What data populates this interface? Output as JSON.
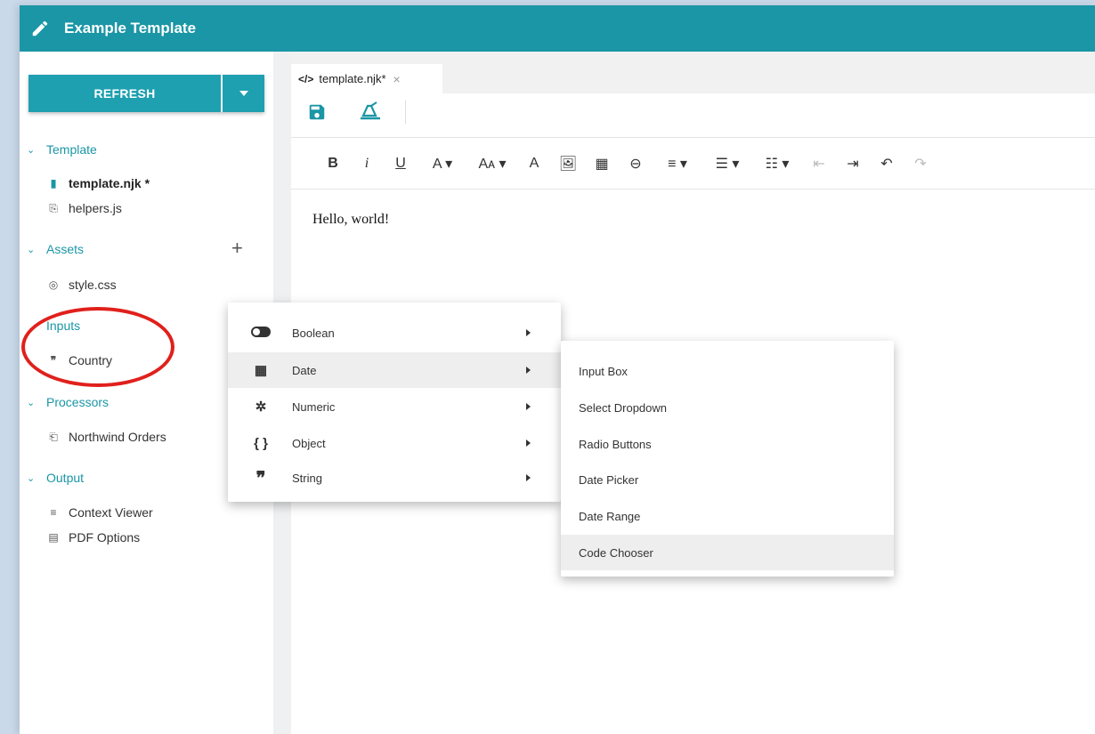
{
  "app": {
    "title": "Example Template"
  },
  "sidebar": {
    "refresh_label": "REFRESH",
    "sections": {
      "template": {
        "label": "Template",
        "items": [
          {
            "label": "template.njk *",
            "icon": "file-icon"
          },
          {
            "label": "helpers.js",
            "icon": "script-icon"
          }
        ]
      },
      "assets": {
        "label": "Assets",
        "add_icon": "+",
        "items": [
          {
            "label": "style.css",
            "icon": "palette-icon"
          }
        ]
      },
      "inputs": {
        "label": "Inputs",
        "items": [
          {
            "label": "Country",
            "icon": "quote-icon"
          }
        ]
      },
      "processors": {
        "label": "Processors",
        "items": [
          {
            "label": "Northwind Orders",
            "icon": "processor-icon"
          }
        ]
      },
      "output": {
        "label": "Output",
        "items": [
          {
            "label": "Context Viewer",
            "icon": "lines-icon"
          },
          {
            "label": "PDF Options",
            "icon": "pdf-icon"
          }
        ]
      }
    }
  },
  "editor": {
    "tab_label": "template.njk*",
    "tab_code_icon": "</>",
    "document_text": "Hello, world!",
    "toolbar": [
      "B",
      "i",
      "U",
      "A ▾",
      "Aᴀ ▾",
      "A",
      "🖼",
      "▦",
      "⊖",
      "≡ ▾",
      "☰ ▾",
      "☷ ▾",
      "⇤",
      "⇥",
      "↶",
      "↷"
    ]
  },
  "context_menu": {
    "items": [
      {
        "label": "Boolean",
        "icon": "toggle-icon"
      },
      {
        "label": "Date",
        "icon": "calendar-icon"
      },
      {
        "label": "Numeric",
        "icon": "hash-icon"
      },
      {
        "label": "Object",
        "icon": "braces-icon"
      },
      {
        "label": "String",
        "icon": "quote-icon"
      }
    ],
    "highlighted": "Date"
  },
  "submenu": {
    "items": [
      "Input Box",
      "Select Dropdown",
      "Radio Buttons",
      "Date Picker",
      "Date Range",
      "Code Chooser"
    ],
    "highlighted": "Code Chooser"
  },
  "colors": {
    "accent": "#1a96a6",
    "button": "#1ea0b0",
    "annotation": "#e0201c"
  }
}
